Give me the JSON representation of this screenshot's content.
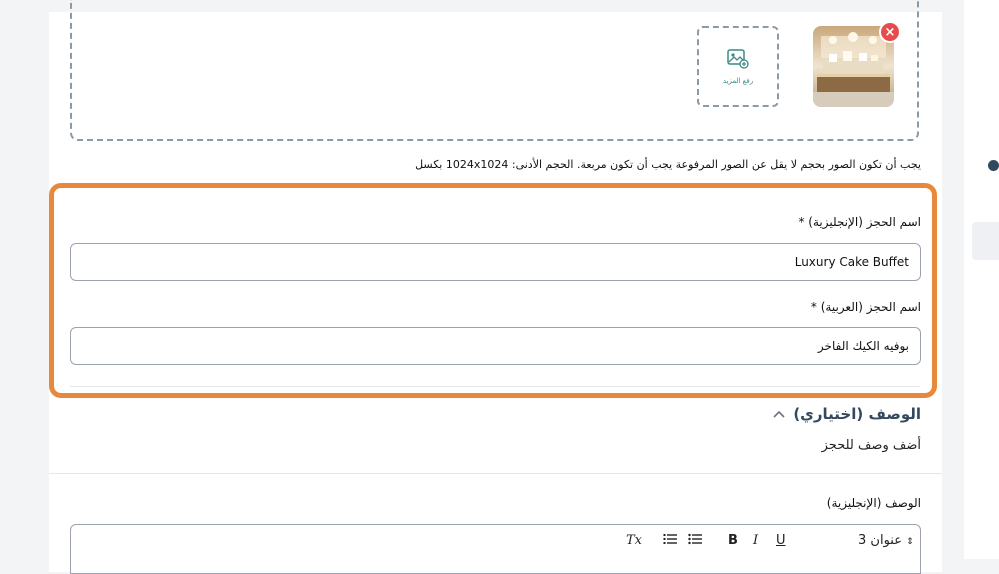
{
  "images": {
    "upload_more_label": "رفع المزيد",
    "remove_label": "×",
    "hint": "يجب أن تكون الصور بحجم لا يقل عن الصور المرفوعة يجب أن تكون مربعة. الحجم الأدنى: 1024x1024 بكسل"
  },
  "booking": {
    "name_en_label": "اسم الحجز (الإنجليزية) *",
    "name_en_value": "Luxury Cake Buffet",
    "name_ar_label": "اسم الحجز (العربية) *",
    "name_ar_value": "بوفيه الكيك الفاخر"
  },
  "description": {
    "title": "الوصف (اختياري)",
    "subtitle": "أضف وصف للحجز",
    "en_label": "الوصف (الإنجليزية)"
  },
  "toolbar": {
    "heading_select": "عنوان 3",
    "bold": "B",
    "italic": "I",
    "underline": "U",
    "clear_format": "Tx"
  },
  "colors": {
    "highlight": "#e8883a",
    "remove": "#e74c4c",
    "accent": "#3a8a86"
  }
}
